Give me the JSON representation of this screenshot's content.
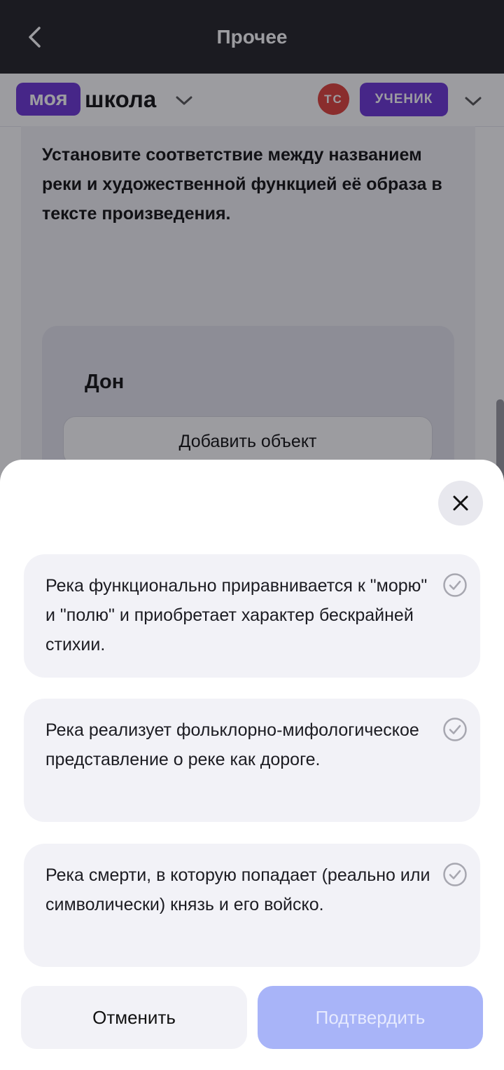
{
  "topbar": {
    "title": "Прочее",
    "back_icon": "chevron-left-icon"
  },
  "appbar": {
    "logo_part1": "моя",
    "logo_part2": "школа",
    "avatar_initials": "ТС",
    "role_label": "УЧЕНИК"
  },
  "task": {
    "question": "Установите соответствие между названием реки и художественной функцией её образа в тексте произведения.",
    "match_label": "Дон",
    "add_object_label": "Добавить объект"
  },
  "sheet": {
    "options": [
      {
        "text": "Река функционально приравнивается к \"морю\" и \"полю\" и приобретает характер бескрайней стихии."
      },
      {
        "text": "Река реализует фольклорно-мифологическое представление о реке как дороге."
      },
      {
        "text": "Река смерти, в которую попадает (реально или символически) князь и его войско."
      }
    ],
    "cancel_label": "Отменить",
    "confirm_label": "Подтвердить"
  },
  "colors": {
    "topbar_bg": "#212125",
    "brand_purple": "#6b35d6",
    "avatar_red": "#e0413a",
    "confirm_disabled": "#a8b4f8"
  }
}
